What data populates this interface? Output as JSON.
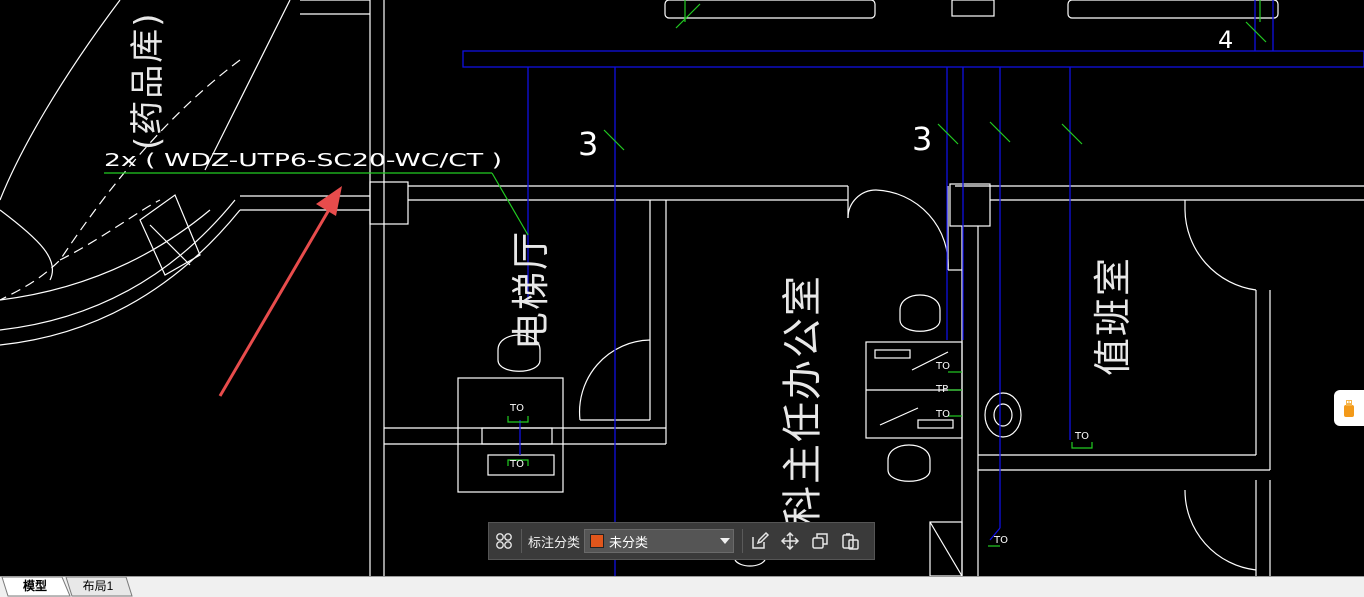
{
  "drawing": {
    "cable_annotation": "2x ( WDZ-UTP6-SC20-WC/CT )",
    "numbers": {
      "left_three": "3",
      "mid_three": "3",
      "top_four": "4"
    },
    "room_labels": {
      "storage": "(药品库)",
      "hallway": "电梯厅",
      "office": "科主任办公室",
      "restroom": "值班室"
    },
    "outlets": {
      "to_reception_upper": "TO",
      "to_reception_lower": "TO",
      "to_office_1": "TO",
      "tp_office": "TP",
      "to_office_2": "TO",
      "to_restroom": "TO",
      "to_bottom": "TO"
    }
  },
  "toolbar": {
    "category_label": "标注分类",
    "category_value": "未分类",
    "category_color": "#e0561c"
  },
  "tabs": [
    {
      "label": "模型",
      "active": true
    },
    {
      "label": "布局1",
      "active": false
    }
  ],
  "colors": {
    "background": "#000000",
    "wall": "#ffffff",
    "cable_blue": "#1010e0",
    "annotation_green": "#22cc22",
    "arrow_red": "#e84c4c"
  }
}
